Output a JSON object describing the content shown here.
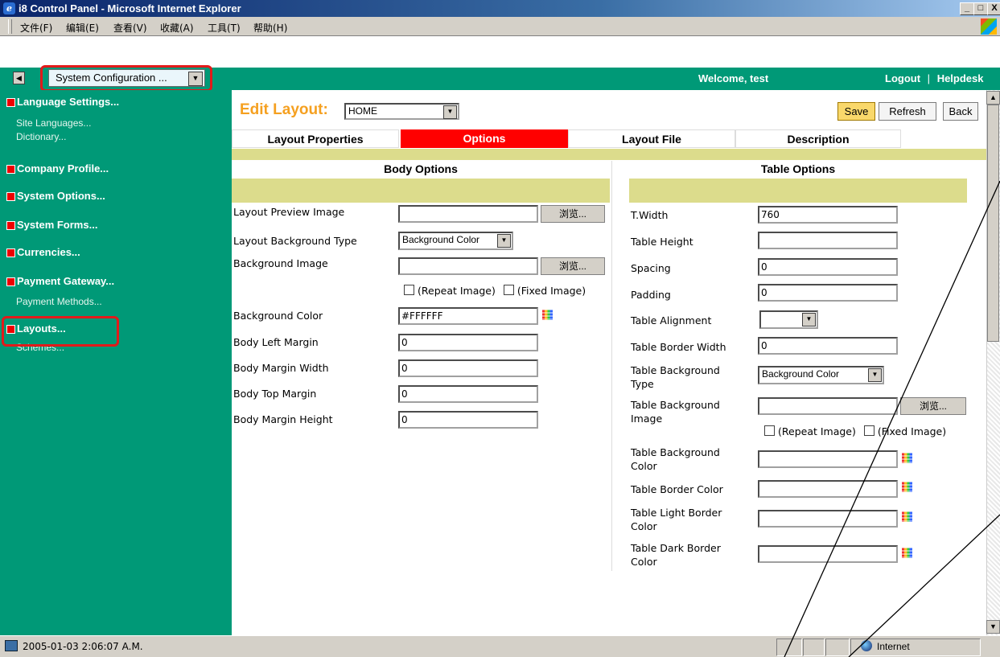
{
  "window": {
    "title": "i8 Control Panel - Microsoft Internet Explorer",
    "controls": [
      "_",
      "□",
      "X"
    ]
  },
  "menubar": {
    "items": [
      "文件(F)",
      "编辑(E)",
      "查看(V)",
      "收藏(A)",
      "工具(T)",
      "帮助(H)"
    ]
  },
  "header": {
    "section_select": "System Configuration ...",
    "welcome": "Welcome, test",
    "logout": "Logout",
    "separator": "|",
    "helpdesk": "Helpdesk"
  },
  "sidebar": {
    "groups": [
      {
        "label": "Language Settings...",
        "subs": [
          "Site Languages...",
          "Dictionary..."
        ]
      },
      {
        "label": "Company Profile...",
        "subs": []
      },
      {
        "label": "System Options...",
        "subs": []
      },
      {
        "label": "System Forms...",
        "subs": []
      },
      {
        "label": "Currencies...",
        "subs": []
      },
      {
        "label": "Payment Gateway...",
        "subs": [
          "Payment Methods..."
        ]
      },
      {
        "label": "Layouts...",
        "subs": [
          "Schemes..."
        ]
      }
    ]
  },
  "main": {
    "edit_layout_label": "Edit Layout:",
    "layout_select": "HOME",
    "buttons": {
      "save": "Save",
      "refresh": "Refresh",
      "back": "Back"
    },
    "tabs": [
      "Layout Properties",
      "Options",
      "Layout File",
      "Description"
    ],
    "active_tab": "Options"
  },
  "body_options": {
    "title": "Body Options",
    "browse": "浏览...",
    "layout_preview_image": {
      "label": "Layout Preview Image",
      "value": ""
    },
    "layout_background_type": {
      "label": "Layout Background Type",
      "value": "Background Color"
    },
    "background_image": {
      "label": "Background Image",
      "value": ""
    },
    "repeat_image": "(Repeat Image)",
    "fixed_image": "(Fixed Image)",
    "background_color": {
      "label": "Background Color",
      "value": "#FFFFFF"
    },
    "body_left_margin": {
      "label": "Body Left Margin",
      "value": "0"
    },
    "body_margin_width": {
      "label": "Body Margin Width",
      "value": "0"
    },
    "body_top_margin": {
      "label": "Body Top Margin",
      "value": "0"
    },
    "body_margin_height": {
      "label": "Body Margin Height",
      "value": "0"
    }
  },
  "table_options": {
    "title": "Table Options",
    "browse": "浏览...",
    "t_width": {
      "label": "T.Width",
      "value": "760"
    },
    "table_height": {
      "label": "Table Height",
      "value": ""
    },
    "spacing": {
      "label": "Spacing",
      "value": "0"
    },
    "padding": {
      "label": "Padding",
      "value": "0"
    },
    "table_alignment": {
      "label": "Table Alignment",
      "value": ""
    },
    "table_border_width": {
      "label": "Table Border Width",
      "value": "0"
    },
    "table_background_type": {
      "label_l1": "Table Background",
      "label_l2": "Type",
      "value": "Background Color"
    },
    "table_background_image": {
      "label_l1": "Table Background",
      "label_l2": "Image",
      "value": ""
    },
    "repeat_image": "(Repeat Image)",
    "fixed_image": "(Fixed Image)",
    "table_background_color": {
      "label_l1": "Table Background",
      "label_l2": "Color",
      "value": ""
    },
    "table_border_color": {
      "label": "Table Border Color",
      "value": ""
    },
    "table_light_border_color": {
      "label_l1": "Table Light Border",
      "label_l2": "Color",
      "value": ""
    },
    "table_dark_border_color": {
      "label_l1": "Table Dark Border",
      "label_l2": "Color",
      "value": ""
    }
  },
  "statusbar": {
    "text": "2005-01-03 2:06:07 A.M.",
    "zone": "Internet"
  },
  "colors": {
    "teal": "#009977",
    "active_tab": "#ff0000",
    "olive": "#dcdc8c",
    "edit_label": "#f5a020",
    "highlight": "#e21a1a"
  }
}
